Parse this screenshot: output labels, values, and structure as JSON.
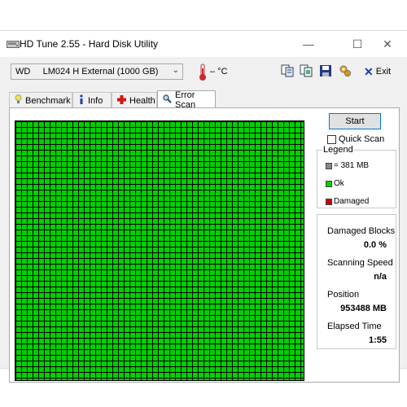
{
  "window": {
    "title": "HD Tune 2.55 - Hard Disk Utility",
    "minimize": "—",
    "maximize": "☐",
    "close": "✕"
  },
  "toolbar": {
    "drive": "WD     LM024 H External (1000 GB)",
    "temperature": "– °C",
    "exit_label": "Exit"
  },
  "tabs": [
    {
      "label": "Benchmark",
      "icon": "lightbulb-icon"
    },
    {
      "label": "Info",
      "icon": "info-icon"
    },
    {
      "label": "Health",
      "icon": "health-cross-icon"
    },
    {
      "label": "Error Scan",
      "icon": "magnifier-icon"
    }
  ],
  "active_tab": "Error Scan",
  "scan": {
    "start_label": "Start",
    "quick_scan_label": "Quick Scan",
    "quick_scan_checked": false,
    "grid_color": "#00d000",
    "blocks_ok_fraction": 1.0
  },
  "legend": {
    "title": "Legend",
    "items": [
      {
        "label": "= 381 MB",
        "color": "#888888"
      },
      {
        "label": "Ok",
        "color": "#00d000"
      },
      {
        "label": "Damaged",
        "color": "#d00000"
      }
    ]
  },
  "stats": {
    "damaged_blocks_label": "Damaged Blocks",
    "damaged_blocks_value": "0.0 %",
    "scanning_speed_label": "Scanning Speed",
    "scanning_speed_value": "n/a",
    "position_label": "Position",
    "position_value": "953488 MB",
    "elapsed_label": "Elapsed Time",
    "elapsed_value": "1:55"
  }
}
